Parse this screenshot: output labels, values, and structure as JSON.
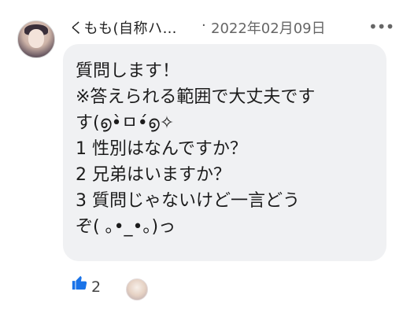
{
  "post": {
    "author_name": "くもも(自称ハ…",
    "separator": "·",
    "timestamp": "2022年02月09日",
    "more_label": "•••"
  },
  "message": {
    "lines": [
      "質問します！",
      "※答えられる範囲で大丈夫です",
      "す(൭•̀ㅁ•́൭✧",
      "1  性別はなんですか？",
      "2  兄弟はいますか？",
      "3  質問じゃないけど一言どう",
      "ぞ( ｡•_•｡)っ"
    ]
  },
  "reactions": {
    "like_count": "2",
    "like_icon": "thumbs-up-icon",
    "like_color": "#1a73e8"
  },
  "colors": {
    "bubble": "#f0f1f3",
    "text": "#1c1c1c",
    "meta": "#666666"
  }
}
